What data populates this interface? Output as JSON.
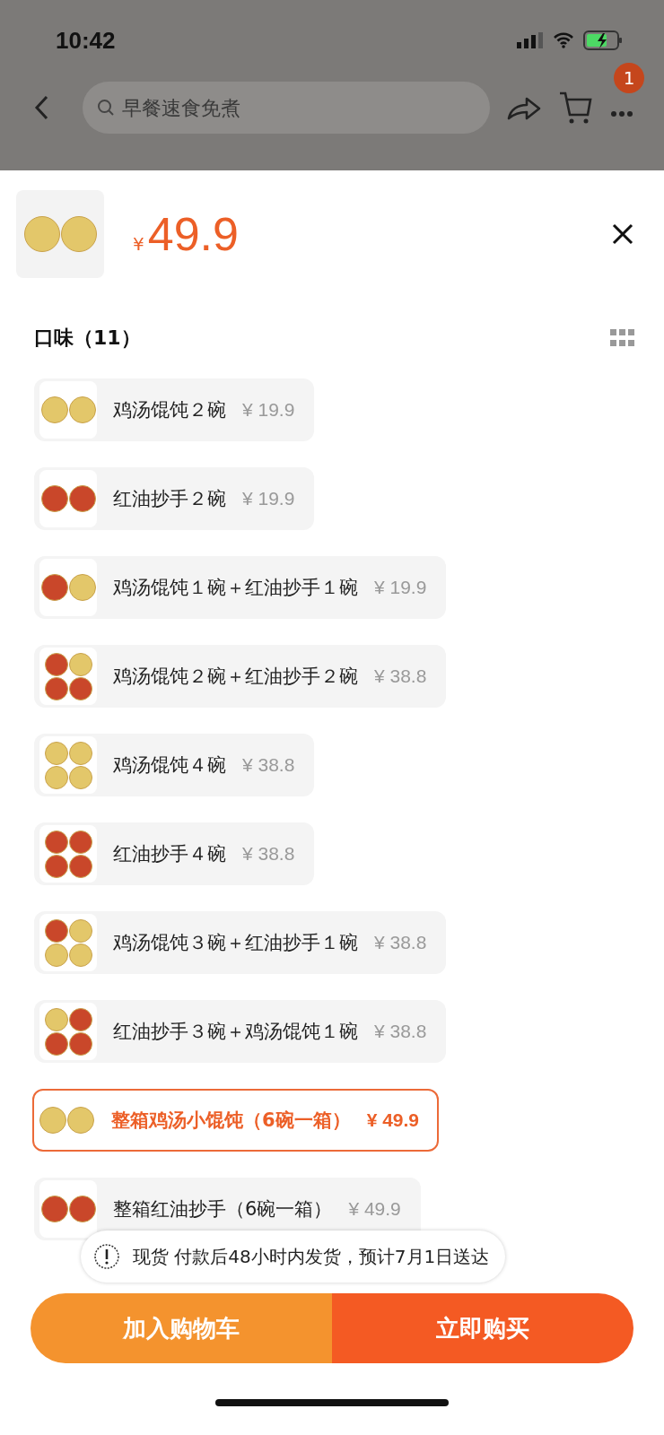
{
  "status_bar": {
    "time": "10:42"
  },
  "nav": {
    "search": {
      "placeholder": "早餐速食免煮"
    },
    "cart_badge": "1"
  },
  "product": {
    "currency": "¥",
    "price": "49.9"
  },
  "flavor": {
    "title": "口味（11）",
    "options": [
      {
        "label": "鸡汤馄饨２碗",
        "price": "¥ 19.9",
        "bowls": [
          {
            "kind": "chicken"
          },
          {
            "kind": "chicken"
          }
        ],
        "selected": false
      },
      {
        "label": "红油抄手２碗",
        "price": "¥ 19.9",
        "bowls": [
          {
            "kind": "chili"
          },
          {
            "kind": "chili"
          }
        ],
        "selected": false
      },
      {
        "label": "鸡汤馄饨１碗＋红油抄手１碗",
        "price": "¥ 19.9",
        "bowls": [
          {
            "kind": "chili"
          },
          {
            "kind": "chicken"
          }
        ],
        "selected": false
      },
      {
        "label": "鸡汤馄饨２碗＋红油抄手２碗",
        "price": "¥ 38.8",
        "bowls": [
          {
            "kind": "chili"
          },
          {
            "kind": "chicken"
          },
          {
            "kind": "chili"
          },
          {
            "kind": "chili"
          }
        ],
        "selected": false
      },
      {
        "label": "鸡汤馄饨４碗",
        "price": "¥ 38.8",
        "bowls": [
          {
            "kind": "chicken"
          },
          {
            "kind": "chicken"
          },
          {
            "kind": "chicken"
          },
          {
            "kind": "chicken"
          }
        ],
        "selected": false
      },
      {
        "label": "红油抄手４碗",
        "price": "¥ 38.8",
        "bowls": [
          {
            "kind": "chili"
          },
          {
            "kind": "chili"
          },
          {
            "kind": "chili"
          },
          {
            "kind": "chili"
          }
        ],
        "selected": false
      },
      {
        "label": "鸡汤馄饨３碗＋红油抄手１碗",
        "price": "¥ 38.8",
        "bowls": [
          {
            "kind": "chili"
          },
          {
            "kind": "chicken"
          },
          {
            "kind": "chicken"
          },
          {
            "kind": "chicken"
          }
        ],
        "selected": false
      },
      {
        "label": "红油抄手３碗＋鸡汤馄饨１碗",
        "price": "¥ 38.8",
        "bowls": [
          {
            "kind": "chicken"
          },
          {
            "kind": "chili"
          },
          {
            "kind": "chili"
          },
          {
            "kind": "chili"
          }
        ],
        "selected": false
      },
      {
        "label": "整箱鸡汤小馄饨（6碗一箱）",
        "price": "¥ 49.9",
        "bowls": [
          {
            "kind": "chicken"
          },
          {
            "kind": "chicken"
          }
        ],
        "selected": true
      },
      {
        "label": "整箱红油抄手（6碗一箱）",
        "price": "¥ 49.9",
        "bowls": [
          {
            "kind": "chili"
          },
          {
            "kind": "chili"
          }
        ],
        "selected": false
      }
    ]
  },
  "notice": {
    "text": "现货 付款后48小时内发货，预计7月1日送达"
  },
  "buttons": {
    "add_to_cart": "加入购物车",
    "buy_now": "立即购买"
  }
}
